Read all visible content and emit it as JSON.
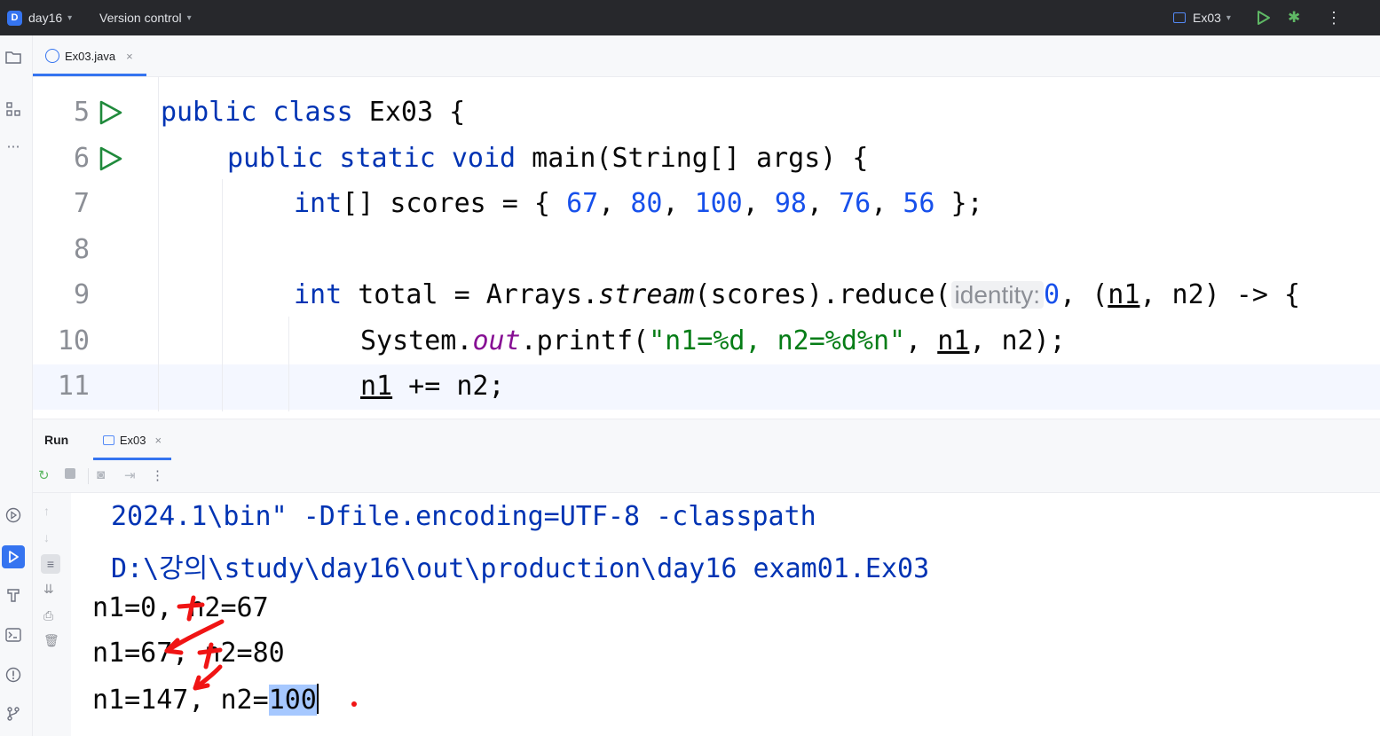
{
  "titlebar": {
    "project_badge": "D",
    "project_name": "day16",
    "vcs": "Version control",
    "run_config": "Ex03"
  },
  "editor": {
    "tab_label": "Ex03.java",
    "close_glyph": "×",
    "lines": [
      {
        "number": "5"
      },
      {
        "number": "6"
      },
      {
        "number": "7"
      },
      {
        "number": "8"
      },
      {
        "number": "9"
      },
      {
        "number": "10"
      },
      {
        "number": "11"
      }
    ],
    "code": {
      "l5_kw": "public class",
      "l5_rest": " Ex03 {",
      "l6_kw": "public static void",
      "l6_rest": " main(String[] args) {",
      "l7_kw": "int",
      "l7_a": "[] scores = { ",
      "l7_n1": "67",
      "l7_n2": "80",
      "l7_n3": "100",
      "l7_n4": "98",
      "l7_n5": "76",
      "l7_n6": "56",
      "l7_end": " };",
      "l9_kw": "int",
      "l9_a": " total = Arrays.",
      "l9_stream": "stream",
      "l9_b": "(scores).reduce(",
      "l9_hint": "identity:",
      "l9_zero": "0",
      "l9_c": ", (",
      "l9_n1": "n1",
      "l9_d": ", n2) -> {",
      "l10_a": "System.",
      "l10_out": "out",
      "l10_b": ".printf(",
      "l10_str": "\"n1=%d, n2=%d%n\"",
      "l10_c": ", ",
      "l10_n1": "n1",
      "l10_d": ", n2);",
      "l11_n1": "n1",
      "l11_rest": " += n2;"
    }
  },
  "run_panel": {
    "title": "Run",
    "tab_label": "Ex03",
    "console": {
      "cmd1": "2024.1\\bin\" -Dfile.encoding=UTF-8 -classpath",
      "cmd2": "D:\\강의\\study\\day16\\out\\production\\day16 exam01.Ex03",
      "out1": "n1=0, n2=67",
      "out2": "n1=67, n2=80",
      "out3_prefix": "n1=147, n2=",
      "out3_selected": "100"
    }
  },
  "colors": {
    "accent": "#3574f0",
    "keyword": "#0033b3",
    "number": "#1750eb",
    "string": "#067d17",
    "field": "#871094",
    "annotation_ink": "#ff0000"
  }
}
